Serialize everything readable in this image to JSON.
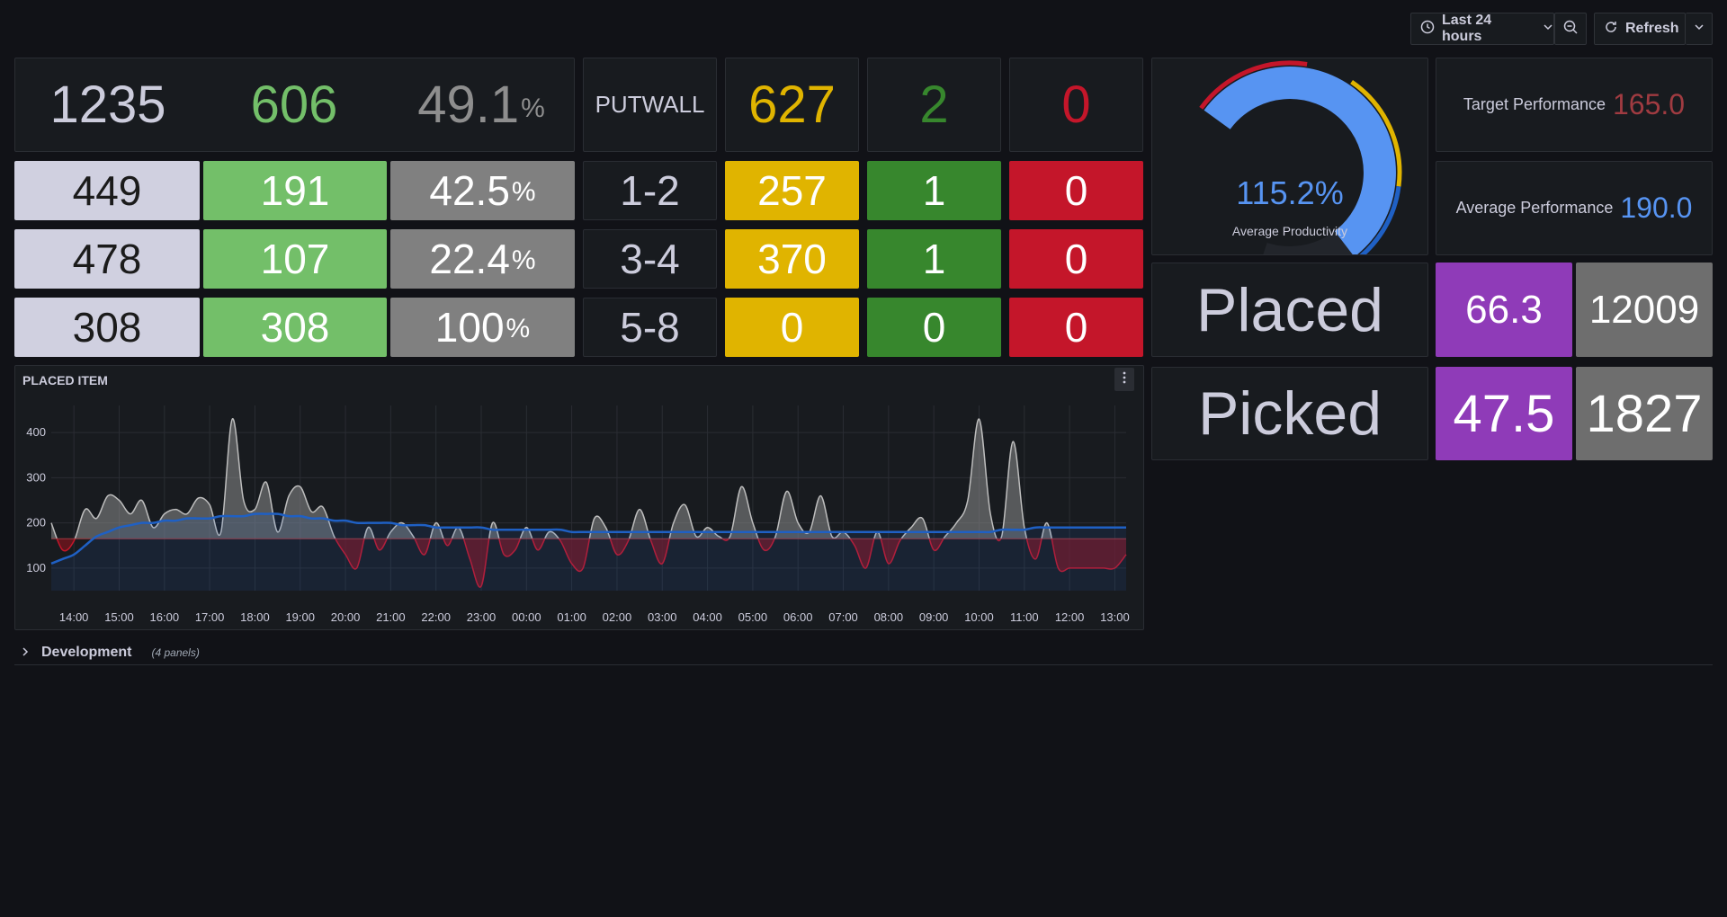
{
  "toolbar": {
    "time_range": "Last 24 hours",
    "refresh": "Refresh",
    "icons": [
      "clock-icon",
      "chevron-down-icon",
      "zoom-out-icon",
      "refresh-icon"
    ]
  },
  "summary": {
    "total": "1235",
    "done": "606",
    "pct": "49.1",
    "pct_unit": "%"
  },
  "rows": [
    {
      "total": "449",
      "done": "191",
      "pct": "42.5",
      "putwall": "1-2",
      "yellow": "257",
      "green": "1",
      "red": "0"
    },
    {
      "total": "478",
      "done": "107",
      "pct": "22.4",
      "putwall": "3-4",
      "yellow": "370",
      "green": "1",
      "red": "0"
    },
    {
      "total": "308",
      "done": "308",
      "pct": "100",
      "putwall": "5-8",
      "yellow": "0",
      "green": "0",
      "red": "0"
    }
  ],
  "putwall_header": {
    "label": "PUTWALL",
    "yellow": "627",
    "green": "2",
    "red": "0"
  },
  "gauge": {
    "value": "115.2%",
    "label": "Average Productivity",
    "fraction": 0.78
  },
  "target": {
    "label": "Target Performance",
    "value": "165.0"
  },
  "average": {
    "label": "Average Performance",
    "value": "190.0"
  },
  "placed": {
    "label": "Placed",
    "rate": "66.3",
    "count": "12009"
  },
  "picked": {
    "label": "Picked",
    "rate": "47.5",
    "count": "1827"
  },
  "section": {
    "title": "Development",
    "subtitle": "(4 panels)"
  },
  "colors": {
    "yellow": "#e0b400",
    "green": "#37872d",
    "red": "#c4162a",
    "purple": "#8f3bb8",
    "blue": "#5794f2",
    "lightgreen": "#73bf69"
  },
  "chart_data": {
    "type": "area",
    "title": "PLACED ITEM",
    "x": [
      "13:30",
      "13:45",
      "14:00",
      "14:15",
      "14:30",
      "14:45",
      "15:00",
      "15:15",
      "15:30",
      "15:45",
      "16:00",
      "16:15",
      "16:30",
      "16:45",
      "17:00",
      "17:15",
      "17:30",
      "17:45",
      "18:00",
      "18:15",
      "18:30",
      "18:45",
      "19:00",
      "19:15",
      "19:30",
      "19:45",
      "20:00",
      "20:15",
      "20:30",
      "20:45",
      "21:00",
      "21:15",
      "21:30",
      "21:45",
      "22:00",
      "22:15",
      "22:30",
      "22:45",
      "23:00",
      "23:15",
      "23:30",
      "23:45",
      "00:00",
      "00:15",
      "00:30",
      "00:45",
      "01:00",
      "01:15",
      "01:30",
      "01:45",
      "02:00",
      "02:15",
      "02:30",
      "02:45",
      "03:00",
      "03:15",
      "03:30",
      "03:45",
      "04:00",
      "04:15",
      "04:30",
      "04:45",
      "05:00",
      "05:15",
      "05:30",
      "05:45",
      "06:00",
      "06:15",
      "06:30",
      "06:45",
      "07:00",
      "07:15",
      "07:30",
      "07:45",
      "08:00",
      "08:15",
      "08:30",
      "08:45",
      "09:00",
      "09:15",
      "09:30",
      "09:45",
      "10:00",
      "10:15",
      "10:30",
      "10:45",
      "11:00",
      "11:15",
      "11:30",
      "11:45",
      "12:00",
      "12:15",
      "12:30",
      "12:45",
      "13:00",
      "13:15"
    ],
    "x_ticks": [
      "14:00",
      "15:00",
      "16:00",
      "17:00",
      "18:00",
      "19:00",
      "20:00",
      "21:00",
      "22:00",
      "23:00",
      "00:00",
      "01:00",
      "02:00",
      "03:00",
      "04:00",
      "05:00",
      "06:00",
      "07:00",
      "08:00",
      "09:00",
      "10:00",
      "11:00",
      "12:00",
      "13:00"
    ],
    "series": [
      {
        "values": [
          200,
          140,
          160,
          230,
          210,
          260,
          250,
          220,
          250,
          190,
          220,
          230,
          220,
          255,
          240,
          180,
          430,
          250,
          230,
          290,
          180,
          260,
          280,
          225,
          235,
          170,
          130,
          100,
          190,
          140,
          180,
          200,
          170,
          130,
          200,
          150,
          190,
          120,
          60,
          200,
          130,
          140,
          190,
          140,
          180,
          160,
          110,
          100,
          210,
          190,
          130,
          160,
          230,
          160,
          110,
          200,
          240,
          170,
          190,
          170,
          170,
          280,
          200,
          140,
          170,
          270,
          200,
          180,
          260,
          170,
          180,
          150,
          100,
          180,
          110,
          160,
          190,
          210,
          140,
          170,
          200,
          250,
          430,
          220,
          170,
          380,
          190,
          120,
          200,
          100,
          100,
          100,
          100,
          100,
          100,
          130
        ]
      },
      {
        "values": [
          110,
          120,
          130,
          150,
          170,
          180,
          190,
          195,
          200,
          200,
          205,
          205,
          210,
          210,
          210,
          215,
          215,
          215,
          220,
          220,
          220,
          215,
          215,
          210,
          210,
          205,
          205,
          200,
          200,
          200,
          200,
          195,
          195,
          195,
          190,
          190,
          190,
          190,
          190,
          185,
          185,
          185,
          185,
          185,
          185,
          185,
          180,
          180,
          180,
          180,
          180,
          180,
          180,
          180,
          180,
          180,
          180,
          180,
          180,
          180,
          180,
          180,
          180,
          180,
          180,
          180,
          180,
          180,
          180,
          180,
          180,
          180,
          180,
          180,
          180,
          180,
          180,
          180,
          180,
          180,
          180,
          180,
          180,
          180,
          185,
          185,
          185,
          190,
          190,
          190,
          190,
          190,
          190,
          190,
          190,
          190
        ]
      }
    ],
    "threshold": 165,
    "ylim": [
      50,
      460
    ],
    "y_ticks": [
      100,
      200,
      300,
      400
    ]
  }
}
